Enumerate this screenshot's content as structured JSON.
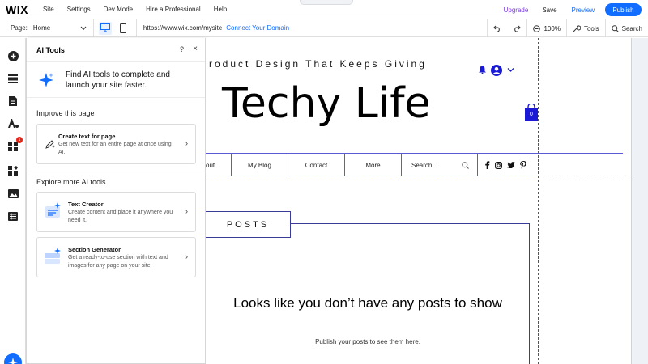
{
  "topbar": {
    "logo": "WIX",
    "menu": [
      "Site",
      "Settings",
      "Dev Mode",
      "Hire a Professional",
      "Help"
    ],
    "upgrade": "Upgrade",
    "save": "Save",
    "preview": "Preview",
    "publish": "Publish"
  },
  "subbar": {
    "page_label": "Page:",
    "page_value": "Home",
    "url": "https://www.wix.com/mysite",
    "connect_domain": "Connect Your Domain",
    "zoom": "100%",
    "tools": "Tools",
    "search": "Search"
  },
  "rail": {
    "icons": [
      "add-icon",
      "sections-icon",
      "pages-icon",
      "design-icon",
      "apps-icon",
      "business-icon",
      "media-icon",
      "cms-icon"
    ],
    "apps_badge": "1"
  },
  "ai_panel": {
    "title": "AI Tools",
    "help": "?",
    "close": "×",
    "intro": "Find AI tools to complete and launch your site faster.",
    "improve_title": "Improve this page",
    "explore_title": "Explore more AI tools",
    "cards": [
      {
        "title": "Create text for page",
        "desc": "Get new text for an entire page at once using AI."
      },
      {
        "title": "Text Creator",
        "desc": "Create content and place it anywhere you need it."
      },
      {
        "title": "Section Generator",
        "desc": "Get a ready-to-use section with text and images for any page on your site."
      }
    ]
  },
  "site": {
    "tagline": "roduct Design That Keeps Giving",
    "title": "Techy Life",
    "cart_count": "0",
    "nav": [
      "out",
      "My Blog",
      "Contact",
      "More"
    ],
    "search_placeholder": "Search...",
    "posts_label": "POSTS",
    "empty_title": "Looks like you don’t have any posts to show",
    "empty_sub": "Publish your posts to see them here."
  },
  "colors": {
    "accent": "#116dff",
    "upgrade": "#7a3fd8",
    "site_blue": "#1a1ad6",
    "nav_line": "#5b5bd6"
  }
}
